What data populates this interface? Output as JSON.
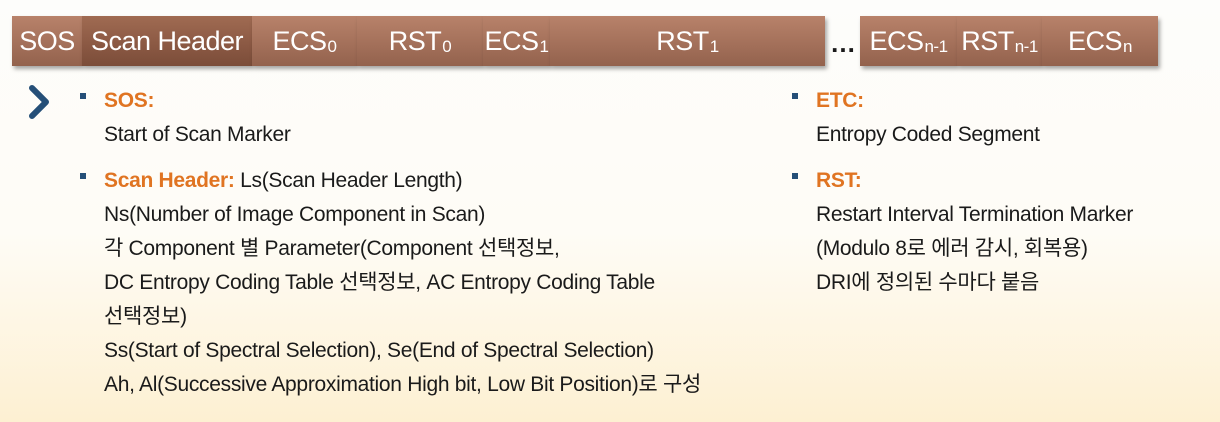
{
  "stream_bar": {
    "cells": [
      {
        "label": "SOS",
        "sub": ""
      },
      {
        "label": "Scan Header",
        "sub": ""
      },
      {
        "label": "ECS",
        "sub": "0"
      },
      {
        "label": "RST",
        "sub": "0"
      },
      {
        "label": "ECS",
        "sub": "1"
      },
      {
        "label": "RST",
        "sub": "1"
      },
      {
        "label": "ECS",
        "sub": "n-1"
      },
      {
        "label": "RST",
        "sub": "n-1"
      },
      {
        "label": "ECS",
        "sub": "n"
      }
    ],
    "ellipsis": "…",
    "colors": {
      "light": "#a26f59",
      "dark": "#8a5843",
      "text": "#ffffff"
    }
  },
  "left": {
    "items": [
      {
        "key": "SOS:",
        "lines": [
          "Start of Scan Marker"
        ]
      },
      {
        "key": "Scan Header:",
        "first_line": " Ls(Scan Header Length)",
        "lines": [
          "Ns(Number of Image Component in Scan)",
          "각 Component 별 Parameter(Component 선택정보,",
          "DC Entropy Coding Table 선택정보, AC Entropy Coding Table",
          "선택정보)",
          "Ss(Start of Spectral Selection), Se(End of Spectral Selection)",
          "Ah, Al(Successive Approximation High bit, Low Bit Position)로 구성"
        ]
      }
    ]
  },
  "right": {
    "items": [
      {
        "key": "ETC:",
        "lines": [
          "Entropy Coded Segment"
        ]
      },
      {
        "key": "RST:",
        "lines": [
          "Restart Interval Termination Marker",
          "(Modulo 8로 에러 감시, 회복용)",
          "DRI에 정의된 수마다 붙음"
        ]
      }
    ]
  },
  "colors": {
    "key": "#e07422",
    "bullet": "#254f78",
    "chevron": "#254f78"
  },
  "icons": {
    "chevron": "chevron-right-icon",
    "bullet": "square-bullet-icon"
  }
}
